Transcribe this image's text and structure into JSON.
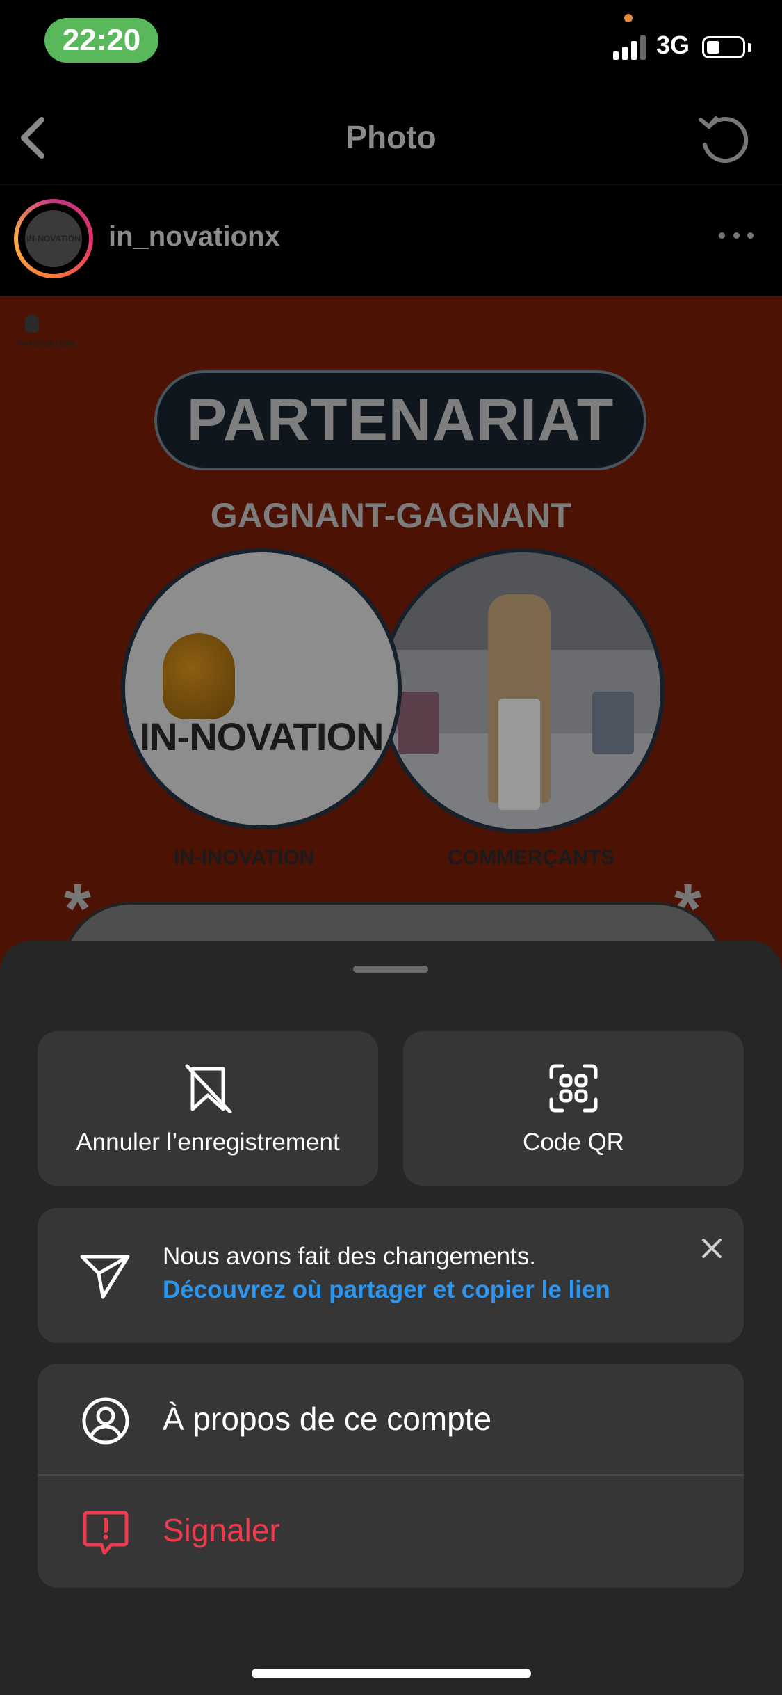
{
  "status_bar": {
    "time": "22:20",
    "network": "3G",
    "icons": [
      "signal-icon",
      "battery-icon"
    ]
  },
  "nav": {
    "title": "Photo",
    "back_icon": "chevron-left-icon",
    "refresh_icon": "refresh-icon"
  },
  "post_header": {
    "username": "in_novationx",
    "more_icon": "more-horizontal-icon"
  },
  "post_image": {
    "mini_logo": "IN-NOVATION",
    "headline": "PARTENARIAT",
    "subheadline": "GAGNANT-GAGNANT",
    "brand_mark": "IN-NOVATION",
    "left_caption": "IN-INOVATION",
    "right_caption": "COMMERÇANTS",
    "asterisk": "*"
  },
  "sheet": {
    "tiles": [
      {
        "label": "Annuler l’enregistrement",
        "icon": "bookmark-slash-icon"
      },
      {
        "label": "Code QR",
        "icon": "qr-code-icon"
      }
    ],
    "notice": {
      "line1": "Nous avons fait des changements.",
      "link": "Découvrez où partager et copier le lien",
      "icon": "send-icon",
      "close_icon": "close-icon"
    },
    "menu": [
      {
        "label": "À propos de ce compte",
        "icon": "account-icon"
      },
      {
        "label": "Signaler",
        "icon": "report-icon"
      }
    ]
  },
  "colors": {
    "accent_link": "#2b95f0",
    "danger": "#ed3a4d",
    "sheet_bg": "#262626",
    "card_bg": "#363636",
    "time_pill": "#58b85b"
  }
}
